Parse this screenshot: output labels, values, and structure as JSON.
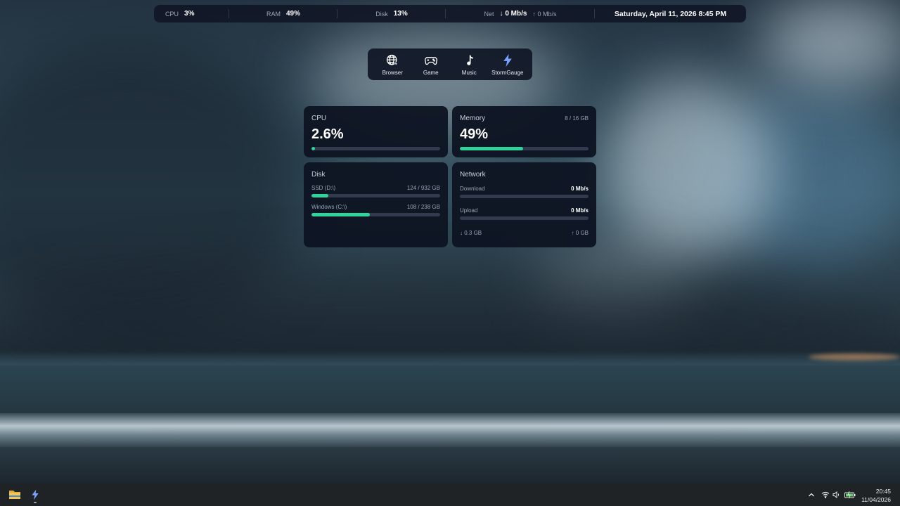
{
  "colors": {
    "accent": "#2fd39c",
    "card_bg": "#0e1422",
    "track": "#323b4d",
    "lightning": "#7aa2ff"
  },
  "topbar": {
    "cpu": {
      "label": "CPU",
      "value": "3%"
    },
    "ram": {
      "label": "RAM",
      "value": "49%"
    },
    "disk": {
      "label": "Disk",
      "value": "13%"
    },
    "net": {
      "label": "Net",
      "down": "0 Mb/s",
      "up": "0 Mb/s",
      "down_icon": "arrow-down-icon",
      "up_icon": "arrow-up-icon"
    },
    "datetime": "Saturday, April 11, 2026 8:45 PM"
  },
  "launcher": {
    "apps": [
      {
        "label": "Browser",
        "icon": "globe-cursor-icon"
      },
      {
        "label": "Game",
        "icon": "gamepad-icon"
      },
      {
        "label": "Music",
        "icon": "music-note-icon"
      },
      {
        "label": "StormGauge",
        "icon": "lightning-icon"
      }
    ]
  },
  "cards": {
    "cpu": {
      "title": "CPU",
      "value": "2.6%",
      "fraction": 0.026
    },
    "memory": {
      "title": "Memory",
      "sub": "8 / 16 GB",
      "value": "49%",
      "fraction": 0.49
    },
    "disk": {
      "title": "Disk",
      "drives": [
        {
          "name": "SSD (D:\\)",
          "usage": "124 / 932 GB",
          "fraction": 0.133
        },
        {
          "name": "Windows (C:\\)",
          "usage": "108 / 238 GB",
          "fraction": 0.454
        }
      ]
    },
    "network": {
      "title": "Network",
      "download": {
        "label": "Download",
        "value": "0 Mb/s",
        "fraction": 0
      },
      "upload": {
        "label": "Upload",
        "value": "0 Mb/s",
        "fraction": 0
      },
      "total_down": "0.3 GB",
      "total_up": "0 GB"
    }
  },
  "taskbar": {
    "pinned": [
      {
        "icon": "folder-icon"
      },
      {
        "icon": "lightning-icon"
      }
    ],
    "tray": [
      "chevron-up-icon",
      "wifi-icon",
      "speaker-icon",
      "battery-icon"
    ],
    "clock": {
      "time": "20:45",
      "date": "11/04/2026"
    }
  }
}
